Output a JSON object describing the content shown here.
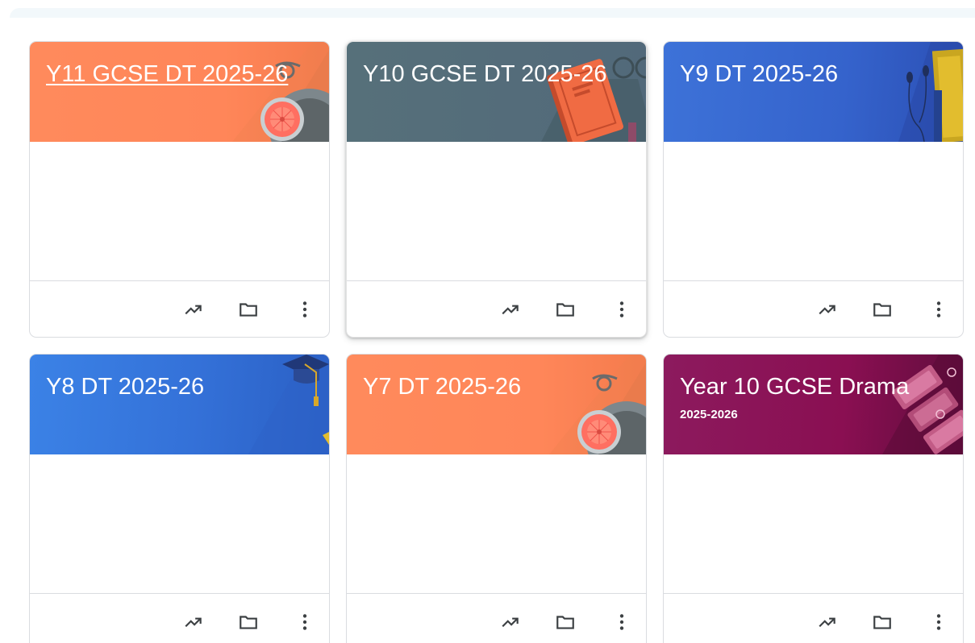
{
  "classes": [
    {
      "title": "Y11 GCSE DT 2025-26",
      "subtitle": "",
      "banner_theme": "orange-disc",
      "banner_colors": [
        "#ff8a5c",
        "#ff7b4f"
      ]
    },
    {
      "title": "Y10 GCSE DT 2025-26",
      "subtitle": "",
      "banner_theme": "slate-book",
      "banner_colors": [
        "#56707a",
        "#4e6670"
      ]
    },
    {
      "title": "Y9 DT 2025-26",
      "subtitle": "",
      "banner_theme": "blue-earphones",
      "banner_colors": [
        "#3b6fd6",
        "#2c4fb7"
      ]
    },
    {
      "title": "Y8 DT 2025-26",
      "subtitle": "",
      "banner_theme": "blue-graduation",
      "banner_colors": [
        "#3b82e6",
        "#2c60c8"
      ]
    },
    {
      "title": "Y7 DT 2025-26",
      "subtitle": "",
      "banner_theme": "orange-disc",
      "banner_colors": [
        "#ff8a5c",
        "#ff7b4f"
      ]
    },
    {
      "title": "Year 10 GCSE Drama",
      "subtitle": "2025-2026",
      "banner_theme": "magenta-tickets",
      "banner_colors": [
        "#8e1458",
        "#6d0f44"
      ]
    }
  ],
  "card_actions": {
    "trend_icon": "trending-up-icon",
    "folder_icon": "folder-icon",
    "more_icon": "more-vert-icon"
  },
  "colors": {
    "icon": "#3c4043",
    "border": "#dadce0",
    "text_on_banner": "#ffffff"
  }
}
